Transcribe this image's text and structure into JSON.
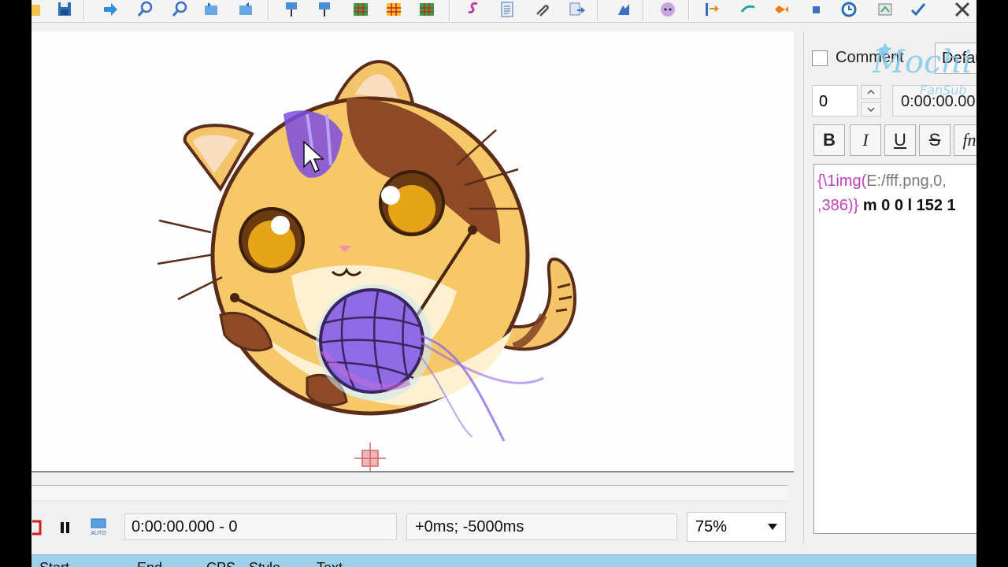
{
  "video": {
    "cursor_hint": "arrow-cursor"
  },
  "controls": {
    "time_display": "0:00:00.000 - 0",
    "offset_display": "+0ms; -5000ms",
    "auto_label": "AUTO",
    "zoom": {
      "selected": "75%"
    }
  },
  "panel": {
    "comment_label": "Comment",
    "style_value": "Defau",
    "layer_value": "0",
    "start_time": "0:00:00.00",
    "format": {
      "bold": "B",
      "italic": "I",
      "underline": "U",
      "strike": "S",
      "font": "fn"
    },
    "text_line1_tag": "{\\1img(",
    "text_line1_path": "E:/fff.png,0,",
    "text_line2_tail": ",386)}",
    "text_line2_draw": " m 0 0 l 152 1"
  },
  "grid": {
    "columns": [
      "Start",
      "End",
      "CPS",
      "Style",
      "Text"
    ]
  },
  "watermark": {
    "text": "Mochi",
    "sub": "FanSub"
  },
  "colors": {
    "background": "#f0f0f0",
    "video_bg": "#fefefe",
    "grid_header": "#9cd0e9",
    "tag_purple": "#c040c0",
    "tag_gray": "#7a7a7a",
    "draw_text": "#111111"
  }
}
